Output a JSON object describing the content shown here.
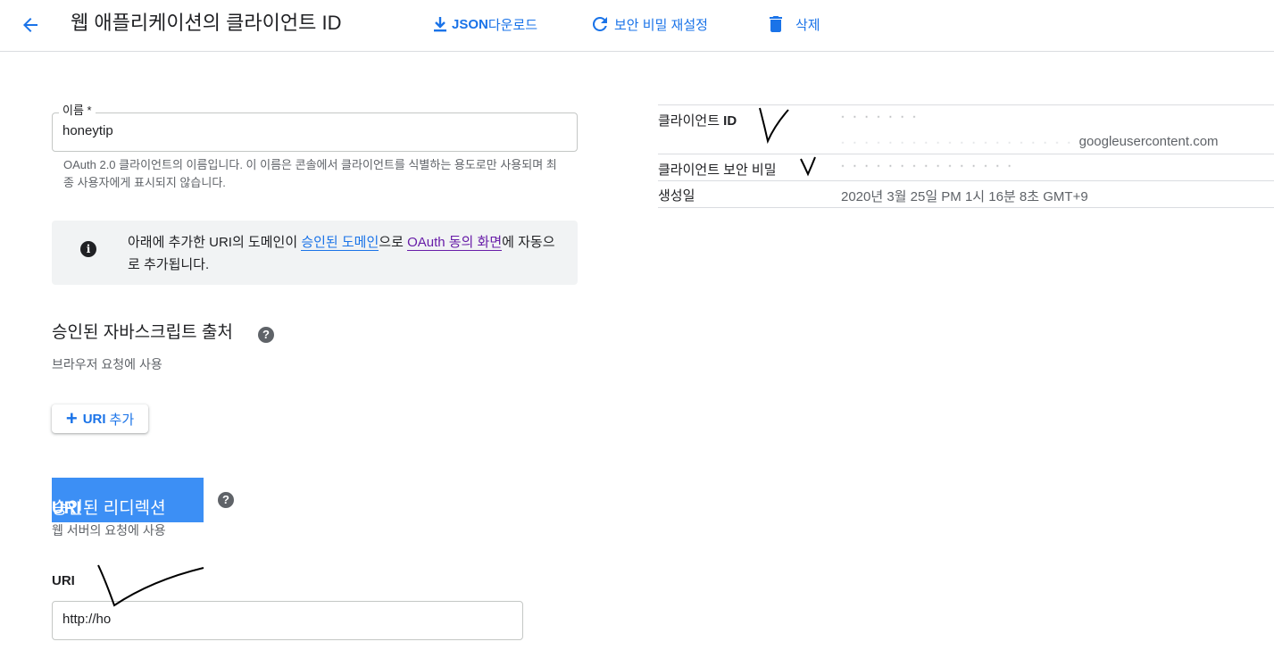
{
  "header": {
    "title": "웹 애플리케이션의 클라이언트 ID",
    "json_bold": "JSON",
    "json_rest": " 다운로드",
    "reset_secret": "보안 비밀 재설정",
    "delete": "삭제"
  },
  "name_field": {
    "label": "이름 *",
    "value": "honeytip",
    "hint": "OAuth 2.0 클라이언트의 이름입니다. 이 이름은 콘솔에서 클라이언트를 식별하는 용도로만 사용되며 최종 사용자에게 표시되지 않습니다."
  },
  "info_box": {
    "text_before": "아래에 추가한 URI의 도메인이 ",
    "link1": "승인된 도메인",
    "text_middle": "으로 ",
    "link2": "OAuth 동의 화면",
    "text_after": "에 자동으로 추가됩니다."
  },
  "js_origins": {
    "title": "승인된 자바스크립트 출처",
    "subtitle": "브라우저 요청에 사용",
    "add_button_bold": "URI",
    "add_button_rest": "추가"
  },
  "redirect_uris": {
    "title_normal": "승인된 리디렉션 ",
    "title_bold": "URI",
    "subtitle": "웹 서버의 요청에 사용",
    "uri_label": "URI",
    "uri_value": "http://ho"
  },
  "details": {
    "client_id_label_normal": "클라이언트 ",
    "client_id_label_bold": "ID",
    "client_id_suffix": "googleusercontent.com",
    "client_secret_label": "클라이언트 보안 비밀",
    "created_label": "생성일",
    "created_value": "2020년 3월 25일 PM 1시 16분 8초 GMT+9"
  },
  "colors": {
    "accent": "#1a73e8",
    "highlight": "#3c8ff5",
    "visited_link": "#681da8"
  }
}
